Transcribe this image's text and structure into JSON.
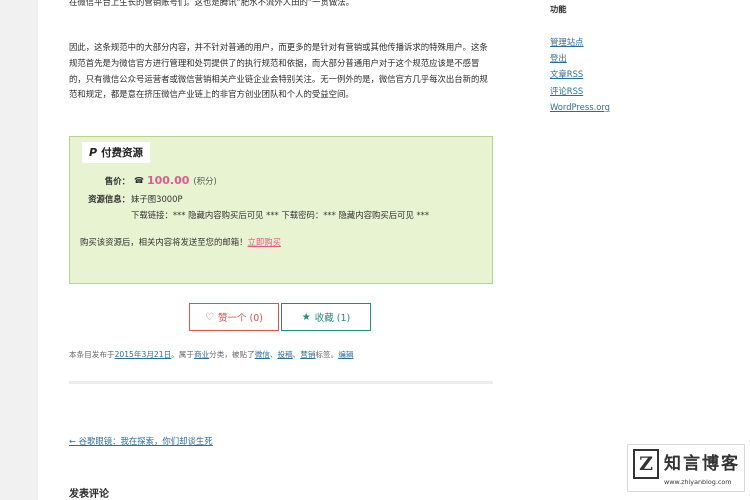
{
  "article": {
    "para_top": "在微信平台上生长的营销账号们。这也是腾讯“肥水不流外人田的”一贯做法。",
    "para2": "因此，这条规范中的大部分内容，并不针对普通的用户，而更多的是针对有营销或其他传播诉求的特殊用户。这条规范首先是为微信官方进行管理和处罚提供了的执行规范和依据，而大部分普通用户对于这个规范应该是不感冒的，只有微信公众号运营者或微信营销相关产业链企业会特别关注。无一例外的是，微信官方几乎每次出台新的规范和规定，都是意在挤压微信产业链上的非官方创业团队和个人的受益空间。"
  },
  "paid_resource": {
    "title": "付费资源",
    "price_label": "售价：",
    "price_value": "100.00",
    "price_unit": "(积分)",
    "info_label": "资源信息：",
    "info_name": "妹子图3000P",
    "download_line": "下载链接：*** 隐藏内容购买后可见 ***   下载密码：*** 隐藏内容购买后可见 ***",
    "buy_note": "购买该资源后，相关内容将发送至您的邮箱！",
    "buy_link": "立即购买"
  },
  "actions": {
    "like_label": "赞一个 (0)",
    "fav_label": "收藏 (1)"
  },
  "meta": {
    "prefix": "本条目发布于",
    "date": "2015年3月21日",
    "mid1": "。属于",
    "category": "商业",
    "mid2": "分类，被贴了",
    "tag1": "微信",
    "tag2": "投稿",
    "tag3": "营销",
    "mid3": "标签。",
    "edit": "编辑"
  },
  "nav": {
    "prev": "← 谷歌眼镜：我在探索，你们却谈生死"
  },
  "reply": {
    "title": "发表评论"
  },
  "sidebar": {
    "heading": "功能",
    "items": [
      {
        "label": "管理站点"
      },
      {
        "label": "登出"
      },
      {
        "label": "文章RSS"
      },
      {
        "label": "评论RSS"
      },
      {
        "label": "WordPress.org"
      }
    ]
  },
  "watermark": {
    "logo_letter": "Z",
    "name": "知言博客",
    "url": "www.zhiyanblog.com"
  },
  "colors": {
    "accent_pink": "#e0588f",
    "like_red": "#d9534f",
    "fav_green": "#1d8f7a",
    "box_bg": "#e8f3d1",
    "link_blue": "#2b6e9e"
  }
}
